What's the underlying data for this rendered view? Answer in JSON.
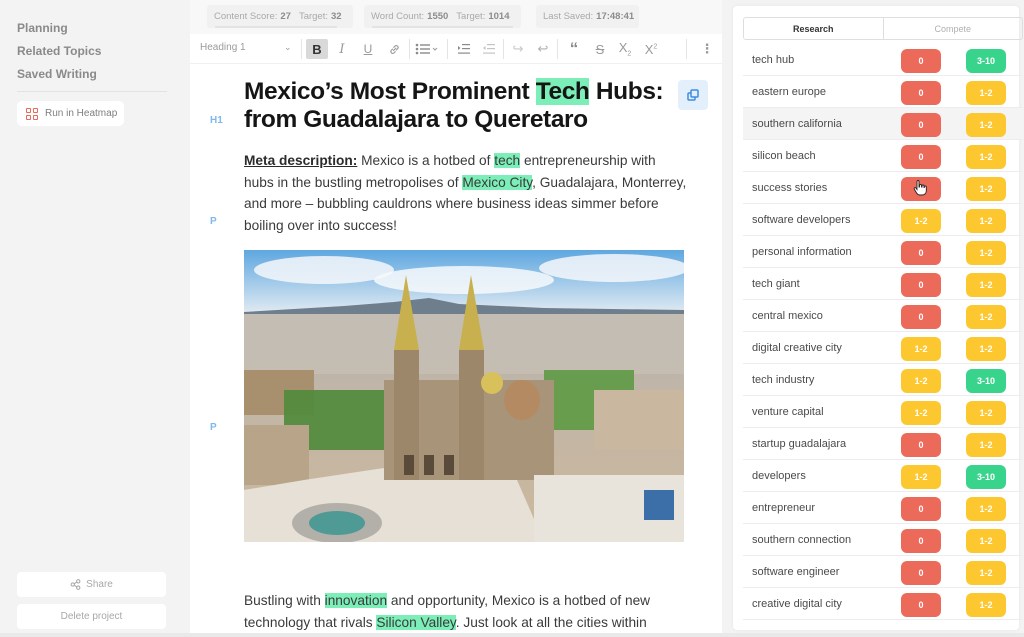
{
  "sidebar": {
    "nav": [
      "Planning",
      "Related Topics",
      "Saved Writing"
    ],
    "run_heatmap_label": "Run in Heatmap",
    "share_label": "Share",
    "delete_label": "Delete project"
  },
  "stats": {
    "content_score_label": "Content Score:",
    "content_score": "27",
    "content_target_label": "Target:",
    "content_target": "32",
    "word_count_label": "Word Count:",
    "word_count": "1550",
    "word_target_label": "Target:",
    "word_target": "1014",
    "last_saved_label": "Last Saved:",
    "last_saved": "17:48:41"
  },
  "toolbar": {
    "block_type": "Heading 1",
    "buttons": [
      "bold",
      "italic",
      "underline",
      "link",
      "bullet-list",
      "indent",
      "outdent",
      "redo",
      "undo",
      "blockquote",
      "strikethrough",
      "subscript",
      "superscript",
      "more"
    ]
  },
  "document": {
    "gutter": {
      "h1": "H1",
      "p1": "P",
      "p2": "P"
    },
    "title_parts": [
      "Mexico’s Most Prominent ",
      "Tech",
      " Hubs: from Guadalajara to Queretaro"
    ],
    "meta_label": "Meta description:",
    "meta_parts": [
      " Mexico is a hotbed of ",
      "tech",
      " entrepreneurship with hubs in the bustling metropolises of ",
      "Mexico City",
      ", Guadalajara, Monterrey, and more – bubbling cauldrons where business ideas simmer before boiling over into success!"
    ],
    "image_alt": "Aerial view of Guadalajara Cathedral and city center",
    "para2_parts": [
      "Bustling with ",
      "innovation",
      " and opportunity, Mexico is a hotbed of new technology that rivals ",
      "Silicon Valley",
      ". Just look at all the cities within"
    ]
  },
  "panel": {
    "tabs": [
      {
        "label": "Research",
        "active": true
      },
      {
        "label": "Compete",
        "active": false
      }
    ],
    "keywords": [
      {
        "term": "tech hub",
        "current": "0",
        "target": "3-10"
      },
      {
        "term": "eastern europe",
        "current": "0",
        "target": "1-2"
      },
      {
        "term": "southern california",
        "current": "0",
        "target": "1-2"
      },
      {
        "term": "silicon beach",
        "current": "0",
        "target": "1-2"
      },
      {
        "term": "success stories",
        "current": "0",
        "target": "1-2"
      },
      {
        "term": "software developers",
        "current": "1-2",
        "target": "1-2"
      },
      {
        "term": "personal information",
        "current": "0",
        "target": "1-2"
      },
      {
        "term": "tech giant",
        "current": "0",
        "target": "1-2"
      },
      {
        "term": "central mexico",
        "current": "0",
        "target": "1-2"
      },
      {
        "term": "digital creative city",
        "current": "1-2",
        "target": "1-2"
      },
      {
        "term": "tech industry",
        "current": "1-2",
        "target": "3-10"
      },
      {
        "term": "venture capital",
        "current": "1-2",
        "target": "1-2"
      },
      {
        "term": "startup guadalajara",
        "current": "0",
        "target": "1-2"
      },
      {
        "term": "developers",
        "current": "1-2",
        "target": "3-10"
      },
      {
        "term": "entrepreneur",
        "current": "0",
        "target": "1-2"
      },
      {
        "term": "southern connection",
        "current": "0",
        "target": "1-2"
      },
      {
        "term": "software engineer",
        "current": "0",
        "target": "1-2"
      },
      {
        "term": "creative digital city",
        "current": "0",
        "target": "1-2"
      }
    ]
  },
  "colors": {
    "red": "#ec6a5a",
    "yellow": "#fdc82f",
    "green": "#39d48c",
    "highlight": "#7ceeb8",
    "gutter_label": "#7fb8ee"
  }
}
